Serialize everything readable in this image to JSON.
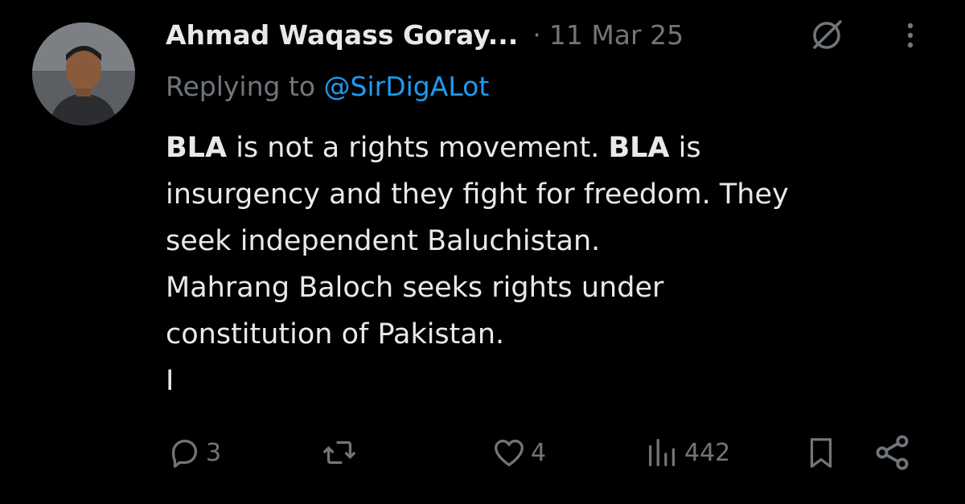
{
  "tweet": {
    "author": {
      "display_name": "Ahmad Waqass Goray...",
      "avatar": "profile-photo"
    },
    "separator": "·",
    "timestamp": "11 Mar 25",
    "reply": {
      "prefix": "Replying to",
      "handle": "@SirDigALot"
    },
    "body": {
      "line1_bold_a": "BLA",
      "line1_text_a": " is not a rights movement.  ",
      "line1_bold_b": "BLA",
      "line1_text_b": " is",
      "line2": "insurgency and they fight for freedom. They",
      "line3": "seek independent Baluchistan.",
      "line4": "Mahrang Baloch seeks rights under",
      "line5": "constitution of Pakistan.",
      "line6": "I"
    },
    "icons": {
      "grok": "grok-icon",
      "more": "more-vertical-icon"
    }
  },
  "actions": {
    "reply_count": "3",
    "repost_count": "",
    "like_count": "4",
    "views_count": "442",
    "icons": [
      "reply-icon",
      "repost-icon",
      "like-icon",
      "views-icon",
      "bookmark-icon",
      "share-icon"
    ]
  },
  "colors": {
    "background": "#000000",
    "text_primary": "#e7e9ea",
    "text_secondary": "#71767b",
    "link": "#1d9bf0"
  }
}
